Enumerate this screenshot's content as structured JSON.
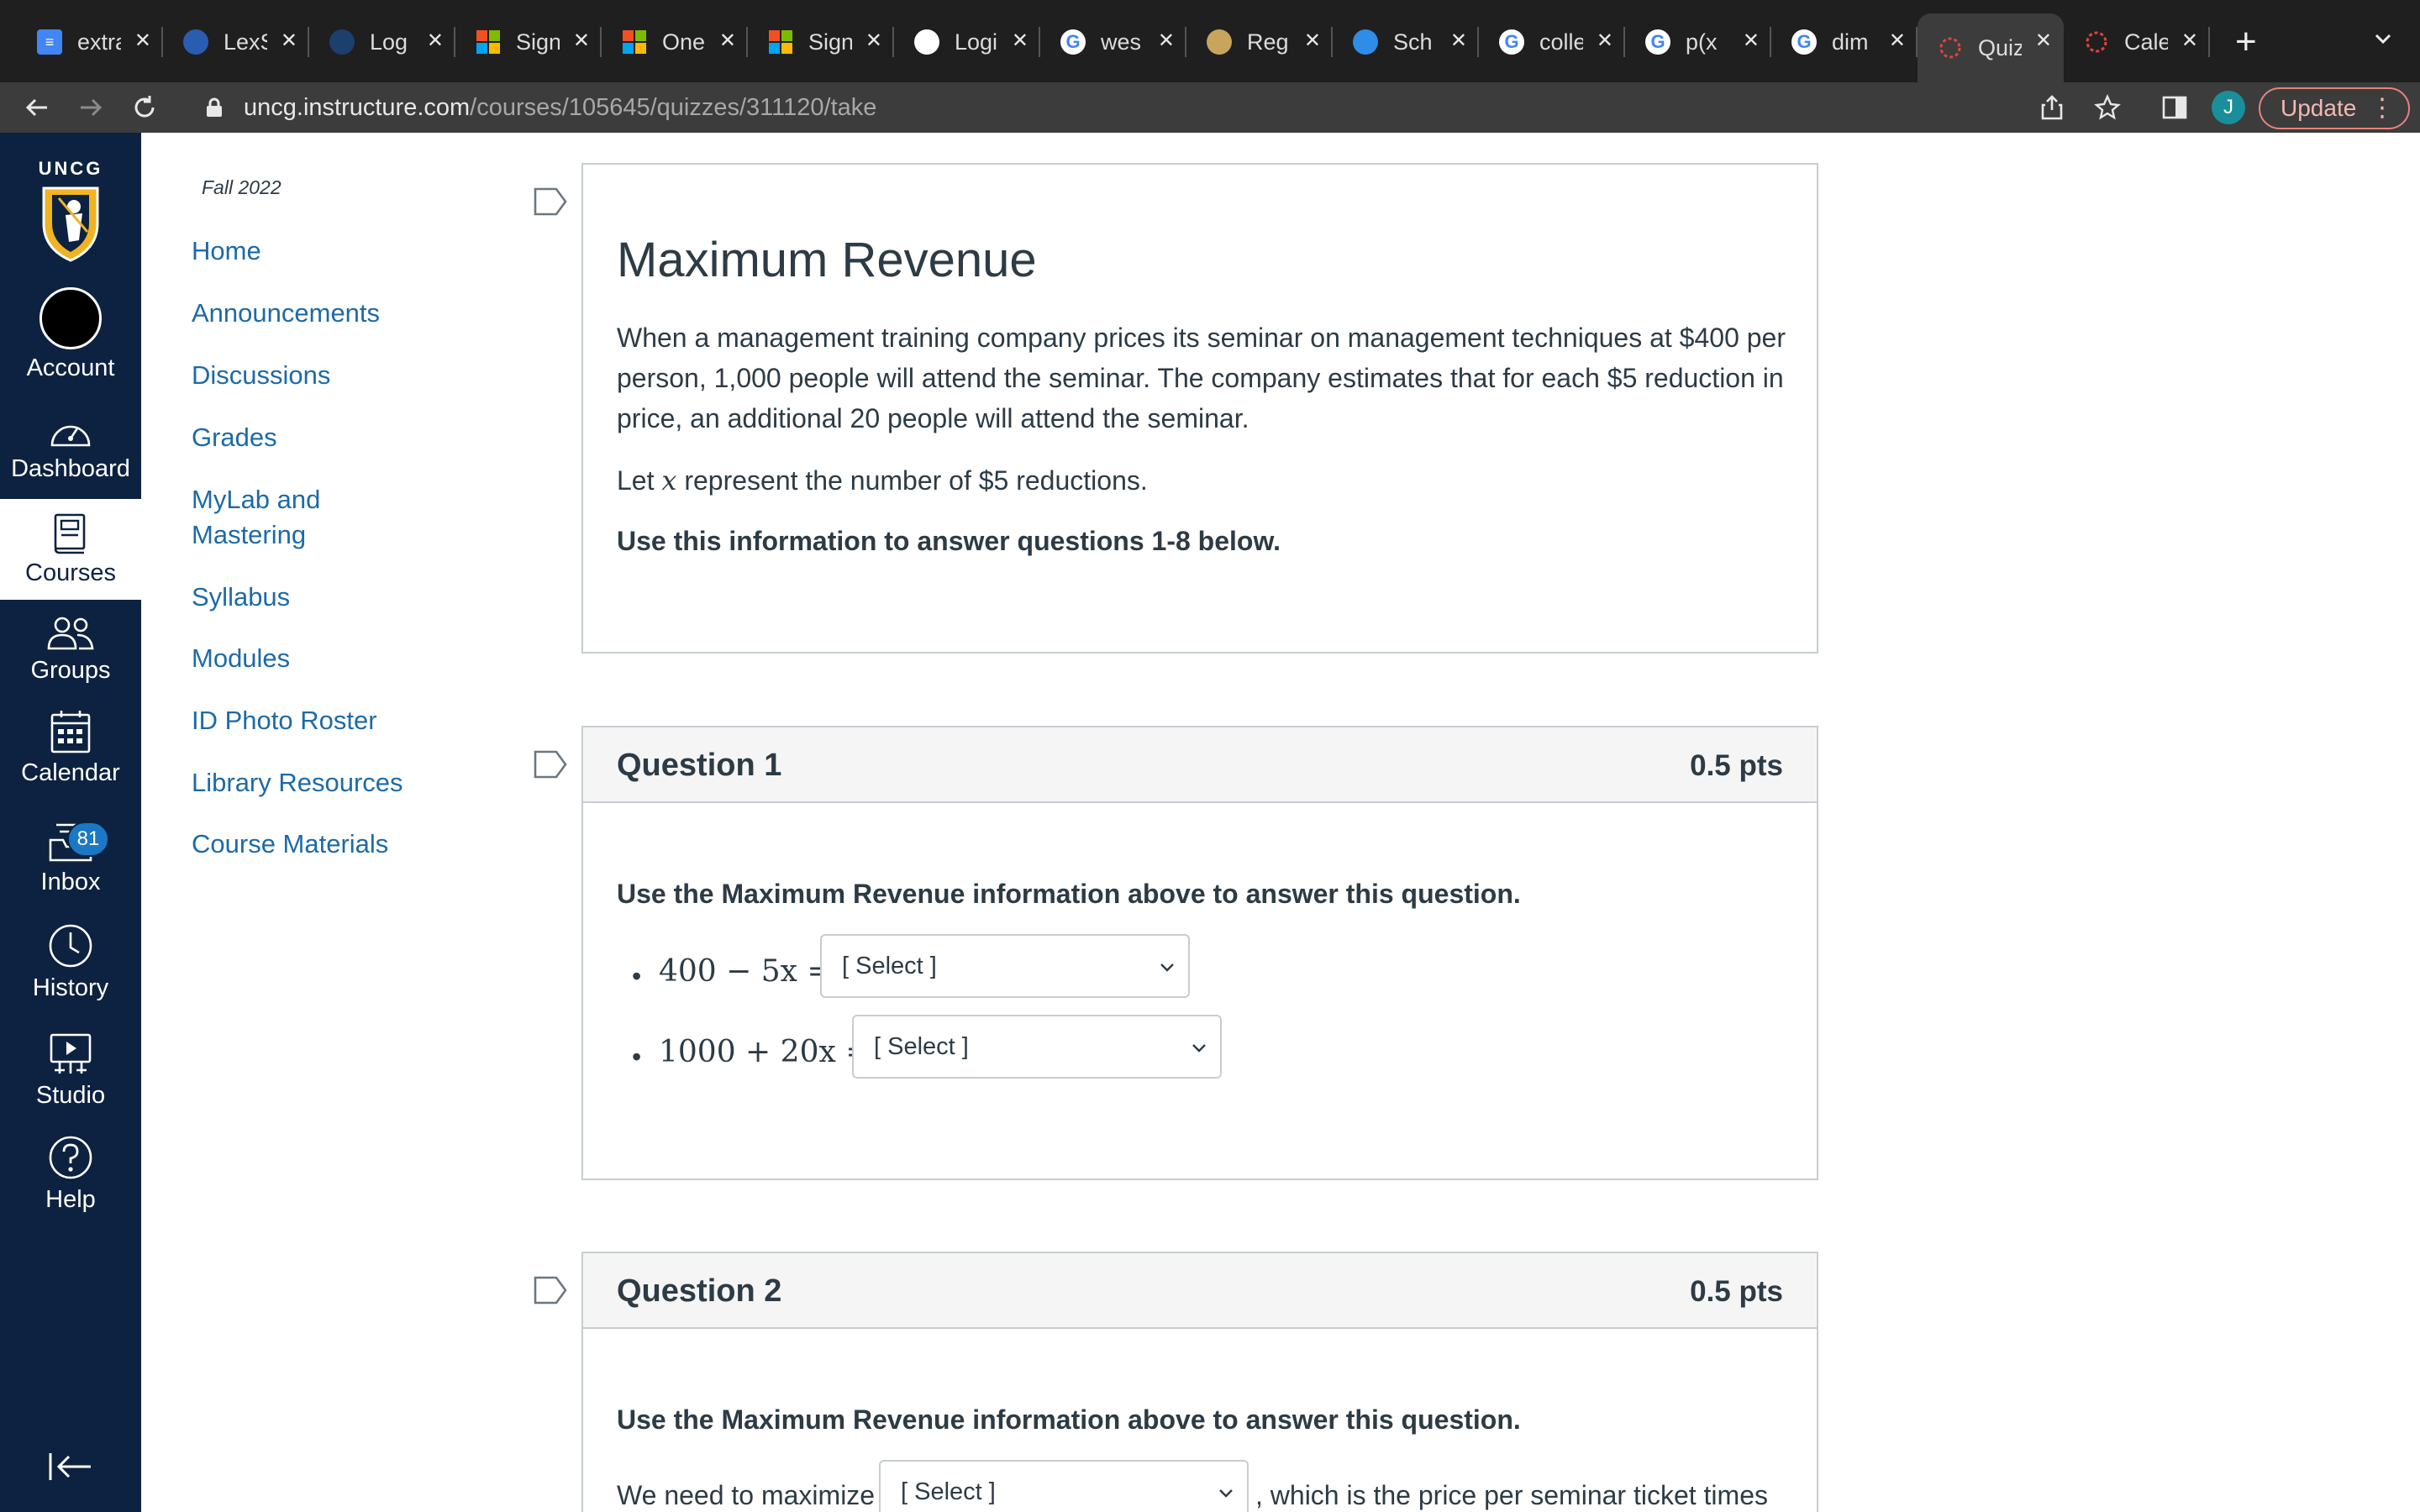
{
  "browser": {
    "tabs": [
      {
        "title": "extra",
        "icon": "google-docs-icon",
        "color": "#4285f4"
      },
      {
        "title": "LexS",
        "icon": "lexis-icon",
        "color": "#2a5db0"
      },
      {
        "title": "Log",
        "icon": "fsa-icon",
        "color": "#1c3f6e"
      },
      {
        "title": "Sign",
        "icon": "microsoft-icon",
        "color": "#f25022"
      },
      {
        "title": "One",
        "icon": "microsoft-icon",
        "color": "#f25022"
      },
      {
        "title": "Sign",
        "icon": "microsoft-icon",
        "color": "#f25022"
      },
      {
        "title": "Logi",
        "icon": "tn-icon",
        "color": "#ffffff"
      },
      {
        "title": "wes",
        "icon": "google-icon",
        "color": "#ffffff"
      },
      {
        "title": "Reg",
        "icon": "reg-icon",
        "color": "#c8a45c"
      },
      {
        "title": "Sch",
        "icon": "c-icon",
        "color": "#2e8de6"
      },
      {
        "title": "colle",
        "icon": "google-icon",
        "color": "#ffffff"
      },
      {
        "title": "p(x",
        "icon": "google-icon",
        "color": "#ffffff"
      },
      {
        "title": "dim",
        "icon": "google-icon",
        "color": "#ffffff"
      },
      {
        "title": "Quiz",
        "icon": "canvas-icon",
        "color": "#e0453a",
        "active": true
      },
      {
        "title": "Cale",
        "icon": "canvas-icon",
        "color": "#e0453a"
      }
    ],
    "url_host": "uncg.instructure.com",
    "url_path": "/courses/105645/quizzes/311120/take",
    "profile_initial": "J",
    "update_label": "Update"
  },
  "global_nav": {
    "logo_text": "UNCG",
    "items": [
      {
        "label": "Account",
        "icon": "account-avatar-icon"
      },
      {
        "label": "Dashboard",
        "icon": "dashboard-icon"
      },
      {
        "label": "Courses",
        "icon": "courses-icon",
        "active": true
      },
      {
        "label": "Groups",
        "icon": "groups-icon"
      },
      {
        "label": "Calendar",
        "icon": "calendar-icon"
      },
      {
        "label": "Inbox",
        "icon": "inbox-icon",
        "badge": "81"
      },
      {
        "label": "History",
        "icon": "history-icon"
      },
      {
        "label": "Studio",
        "icon": "studio-icon"
      },
      {
        "label": "Help",
        "icon": "help-icon"
      }
    ]
  },
  "course_nav": {
    "term": "Fall 2022",
    "links": [
      "Home",
      "Announcements",
      "Discussions",
      "Grades",
      "MyLab and Mastering",
      "Syllabus",
      "Modules",
      "ID Photo Roster",
      "Library Resources",
      "Course Materials"
    ]
  },
  "intro": {
    "title": "Maximum Revenue",
    "paragraph": "When a management training company prices its seminar on management techniques at $400 per person, 1,000 people will attend the seminar.  The company estimates that for each $5 reduction in price, an additional 20 people will attend the seminar.",
    "let_prefix": "Let ",
    "let_var": "x",
    "let_suffix": " represent the number of $5 reductions.",
    "instruction": "Use this information to answer questions 1-8 below."
  },
  "questions": [
    {
      "title": "Question 1",
      "points": "0.5 pts",
      "prompt": "Use the Maximum Revenue information above to answer this question.",
      "items": [
        {
          "expr": "400 − 5x =",
          "select": "[ Select ]"
        },
        {
          "expr": "1000 + 20x =",
          "select": "[ Select ]"
        }
      ]
    },
    {
      "title": "Question 2",
      "points": "0.5 pts",
      "prompt": "Use the Maximum Revenue information above to answer this question.",
      "text_prefix": "We need to maximize",
      "select": "[ Select ]",
      "text_suffix": ", which is the price per seminar ticket times"
    }
  ]
}
